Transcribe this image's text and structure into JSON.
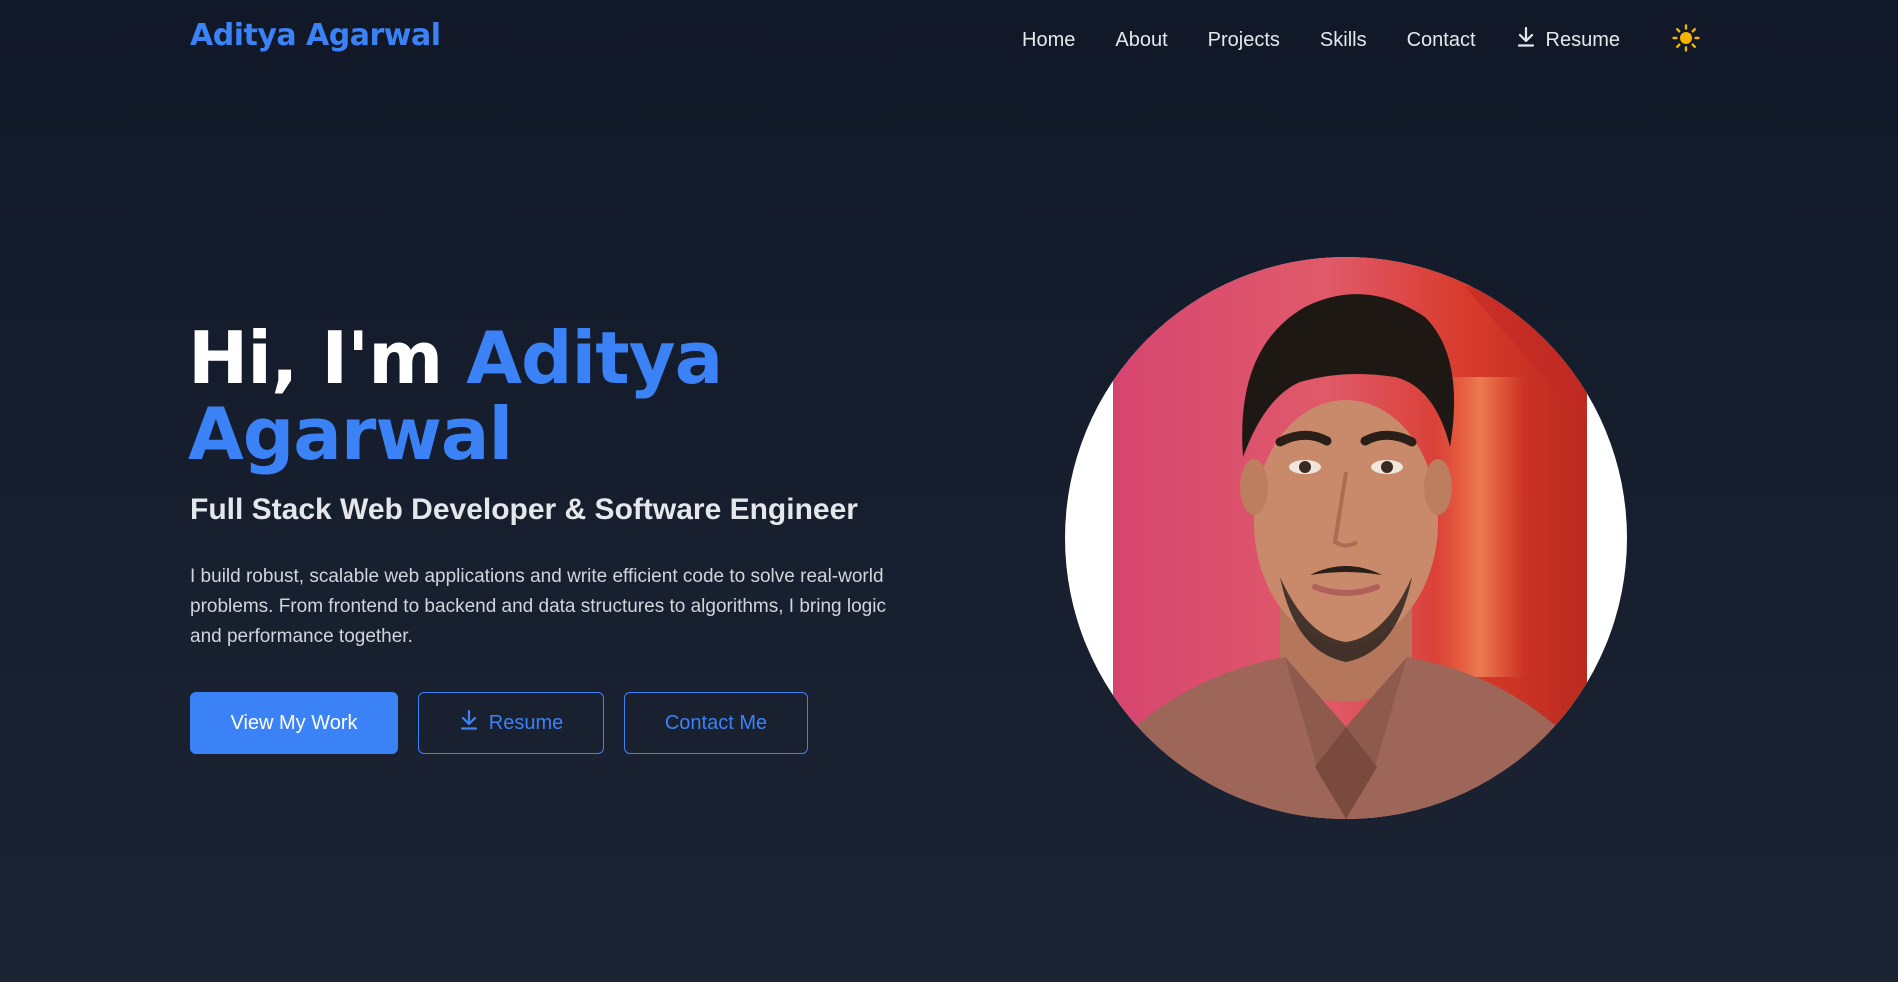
{
  "brand": "Aditya Agarwal",
  "nav": {
    "items": [
      {
        "label": "Home"
      },
      {
        "label": "About"
      },
      {
        "label": "Projects"
      },
      {
        "label": "Skills"
      },
      {
        "label": "Contact"
      }
    ],
    "resume_label": "Resume",
    "theme_icon": "sun-icon"
  },
  "hero": {
    "greeting": "Hi, I'm ",
    "name": "Aditya Agarwal",
    "subtitle": "Full Stack Web Developer & Software Engineer",
    "description": "I build robust, scalable web applications and write efficient code to solve real-world problems. From frontend to backend and data structures to algorithms, I bring logic and performance together.",
    "buttons": {
      "view_work": "View My Work",
      "resume": "Resume",
      "contact": "Contact Me"
    }
  },
  "colors": {
    "accent": "#3b82f6",
    "background": "#111827",
    "sun": "#f5b400"
  }
}
